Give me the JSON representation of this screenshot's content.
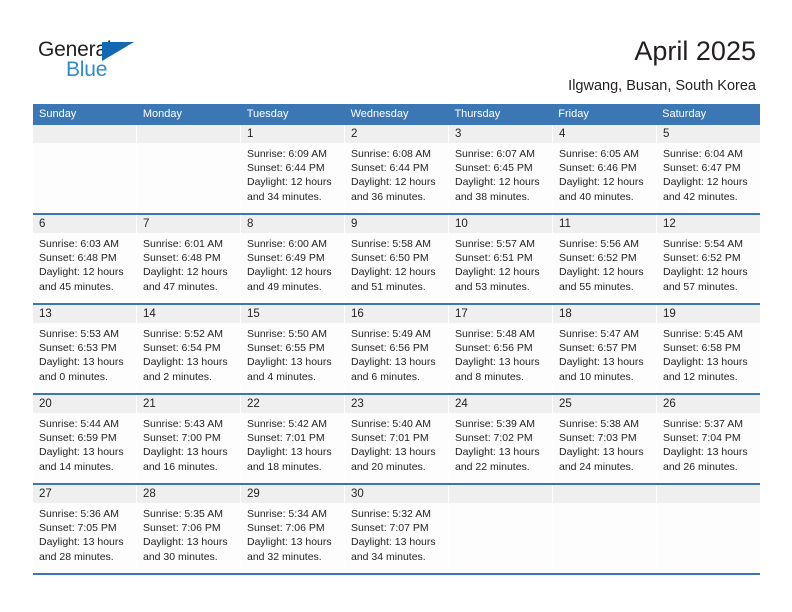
{
  "brand": {
    "name_dark": "General",
    "name_blue": "Blue",
    "accent_dark_blue": "#1268b3",
    "accent_light_blue": "#2e8ad1"
  },
  "header": {
    "title": "April 2025",
    "subtitle": "Ilgwang, Busan, South Korea"
  },
  "colors": {
    "header_blue": "#3b77b5",
    "daynum_band": "#efefef",
    "text": "#231f20"
  },
  "calendar": {
    "weekday_headers": [
      "Sunday",
      "Monday",
      "Tuesday",
      "Wednesday",
      "Thursday",
      "Friday",
      "Saturday"
    ],
    "weeks": [
      [
        {
          "day": "",
          "lines": []
        },
        {
          "day": "",
          "lines": []
        },
        {
          "day": "1",
          "lines": [
            "Sunrise: 6:09 AM",
            "Sunset: 6:44 PM",
            "Daylight: 12 hours",
            "and 34 minutes."
          ]
        },
        {
          "day": "2",
          "lines": [
            "Sunrise: 6:08 AM",
            "Sunset: 6:44 PM",
            "Daylight: 12 hours",
            "and 36 minutes."
          ]
        },
        {
          "day": "3",
          "lines": [
            "Sunrise: 6:07 AM",
            "Sunset: 6:45 PM",
            "Daylight: 12 hours",
            "and 38 minutes."
          ]
        },
        {
          "day": "4",
          "lines": [
            "Sunrise: 6:05 AM",
            "Sunset: 6:46 PM",
            "Daylight: 12 hours",
            "and 40 minutes."
          ]
        },
        {
          "day": "5",
          "lines": [
            "Sunrise: 6:04 AM",
            "Sunset: 6:47 PM",
            "Daylight: 12 hours",
            "and 42 minutes."
          ]
        }
      ],
      [
        {
          "day": "6",
          "lines": [
            "Sunrise: 6:03 AM",
            "Sunset: 6:48 PM",
            "Daylight: 12 hours",
            "and 45 minutes."
          ]
        },
        {
          "day": "7",
          "lines": [
            "Sunrise: 6:01 AM",
            "Sunset: 6:48 PM",
            "Daylight: 12 hours",
            "and 47 minutes."
          ]
        },
        {
          "day": "8",
          "lines": [
            "Sunrise: 6:00 AM",
            "Sunset: 6:49 PM",
            "Daylight: 12 hours",
            "and 49 minutes."
          ]
        },
        {
          "day": "9",
          "lines": [
            "Sunrise: 5:58 AM",
            "Sunset: 6:50 PM",
            "Daylight: 12 hours",
            "and 51 minutes."
          ]
        },
        {
          "day": "10",
          "lines": [
            "Sunrise: 5:57 AM",
            "Sunset: 6:51 PM",
            "Daylight: 12 hours",
            "and 53 minutes."
          ]
        },
        {
          "day": "11",
          "lines": [
            "Sunrise: 5:56 AM",
            "Sunset: 6:52 PM",
            "Daylight: 12 hours",
            "and 55 minutes."
          ]
        },
        {
          "day": "12",
          "lines": [
            "Sunrise: 5:54 AM",
            "Sunset: 6:52 PM",
            "Daylight: 12 hours",
            "and 57 minutes."
          ]
        }
      ],
      [
        {
          "day": "13",
          "lines": [
            "Sunrise: 5:53 AM",
            "Sunset: 6:53 PM",
            "Daylight: 13 hours",
            "and 0 minutes."
          ]
        },
        {
          "day": "14",
          "lines": [
            "Sunrise: 5:52 AM",
            "Sunset: 6:54 PM",
            "Daylight: 13 hours",
            "and 2 minutes."
          ]
        },
        {
          "day": "15",
          "lines": [
            "Sunrise: 5:50 AM",
            "Sunset: 6:55 PM",
            "Daylight: 13 hours",
            "and 4 minutes."
          ]
        },
        {
          "day": "16",
          "lines": [
            "Sunrise: 5:49 AM",
            "Sunset: 6:56 PM",
            "Daylight: 13 hours",
            "and 6 minutes."
          ]
        },
        {
          "day": "17",
          "lines": [
            "Sunrise: 5:48 AM",
            "Sunset: 6:56 PM",
            "Daylight: 13 hours",
            "and 8 minutes."
          ]
        },
        {
          "day": "18",
          "lines": [
            "Sunrise: 5:47 AM",
            "Sunset: 6:57 PM",
            "Daylight: 13 hours",
            "and 10 minutes."
          ]
        },
        {
          "day": "19",
          "lines": [
            "Sunrise: 5:45 AM",
            "Sunset: 6:58 PM",
            "Daylight: 13 hours",
            "and 12 minutes."
          ]
        }
      ],
      [
        {
          "day": "20",
          "lines": [
            "Sunrise: 5:44 AM",
            "Sunset: 6:59 PM",
            "Daylight: 13 hours",
            "and 14 minutes."
          ]
        },
        {
          "day": "21",
          "lines": [
            "Sunrise: 5:43 AM",
            "Sunset: 7:00 PM",
            "Daylight: 13 hours",
            "and 16 minutes."
          ]
        },
        {
          "day": "22",
          "lines": [
            "Sunrise: 5:42 AM",
            "Sunset: 7:01 PM",
            "Daylight: 13 hours",
            "and 18 minutes."
          ]
        },
        {
          "day": "23",
          "lines": [
            "Sunrise: 5:40 AM",
            "Sunset: 7:01 PM",
            "Daylight: 13 hours",
            "and 20 minutes."
          ]
        },
        {
          "day": "24",
          "lines": [
            "Sunrise: 5:39 AM",
            "Sunset: 7:02 PM",
            "Daylight: 13 hours",
            "and 22 minutes."
          ]
        },
        {
          "day": "25",
          "lines": [
            "Sunrise: 5:38 AM",
            "Sunset: 7:03 PM",
            "Daylight: 13 hours",
            "and 24 minutes."
          ]
        },
        {
          "day": "26",
          "lines": [
            "Sunrise: 5:37 AM",
            "Sunset: 7:04 PM",
            "Daylight: 13 hours",
            "and 26 minutes."
          ]
        }
      ],
      [
        {
          "day": "27",
          "lines": [
            "Sunrise: 5:36 AM",
            "Sunset: 7:05 PM",
            "Daylight: 13 hours",
            "and 28 minutes."
          ]
        },
        {
          "day": "28",
          "lines": [
            "Sunrise: 5:35 AM",
            "Sunset: 7:06 PM",
            "Daylight: 13 hours",
            "and 30 minutes."
          ]
        },
        {
          "day": "29",
          "lines": [
            "Sunrise: 5:34 AM",
            "Sunset: 7:06 PM",
            "Daylight: 13 hours",
            "and 32 minutes."
          ]
        },
        {
          "day": "30",
          "lines": [
            "Sunrise: 5:32 AM",
            "Sunset: 7:07 PM",
            "Daylight: 13 hours",
            "and 34 minutes."
          ]
        },
        {
          "day": "",
          "lines": []
        },
        {
          "day": "",
          "lines": []
        },
        {
          "day": "",
          "lines": []
        }
      ]
    ]
  }
}
